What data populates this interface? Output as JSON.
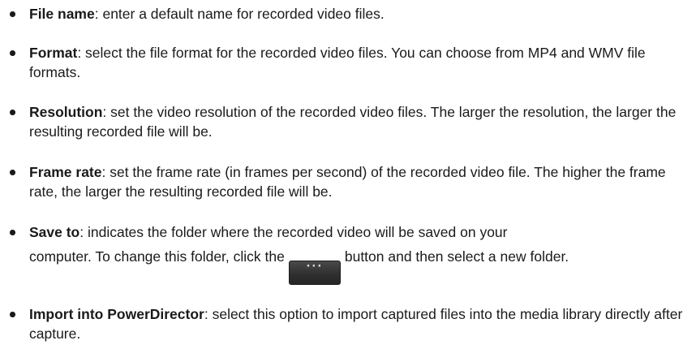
{
  "items": [
    {
      "term": "File name",
      "desc": ": enter a default name for recorded video files."
    },
    {
      "term": "Format",
      "desc": ": select the file format for the recorded video files. You can choose from MP4 and WMV file formats."
    },
    {
      "term": "Resolution",
      "desc": ": set the video resolution of the recorded video files. The larger the resolution, the larger the resulting recorded file will be."
    },
    {
      "term": "Frame rate",
      "desc": ": set the frame rate (in frames per second) of the recorded video file. The higher the frame rate, the larger the resulting recorded file will be."
    },
    {
      "term": "Save to",
      "desc": ": indicates the folder where the recorded video will be saved on your",
      "desc2": "computer. To change this folder, click the",
      "button_label": "···",
      "desc3": "button and then select a new folder."
    },
    {
      "term": "Import into PowerDirector",
      "desc": ": select this option to import captured files into the media library directly after capture."
    }
  ]
}
